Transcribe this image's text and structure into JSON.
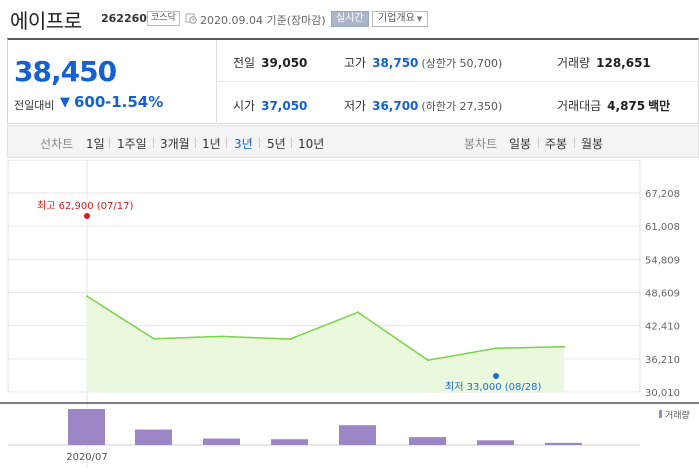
{
  "header": {
    "stock_name": "에이프로",
    "stock_code": "262260",
    "market": "코스닥",
    "date_text": "2020.09.04 기준(장마감)",
    "realtime_button": "실시간",
    "overview_button": "기업개요"
  },
  "quote": {
    "price": "38,450",
    "change_label": "전일대비",
    "change_value": "600",
    "change_rate": "-1.54%",
    "prev_close_label": "전일",
    "prev_close": "39,050",
    "high_label": "고가",
    "high": "38,750",
    "upper_limit": "(상한가 50,700)",
    "volume_label": "거래량",
    "volume": "128,651",
    "open_label": "시가",
    "open": "37,050",
    "low_label": "저가",
    "low": "36,700",
    "lower_limit": "(하한가 27,350)",
    "amount_label": "거래대금",
    "amount": "4,875",
    "amount_unit": "백만"
  },
  "period_bar": {
    "line_chart_label": "선차트",
    "line_options": [
      "1일",
      "1주일",
      "3개월",
      "1년",
      "3년",
      "5년",
      "10년"
    ],
    "active_option": "3년",
    "candle_chart_label": "봉차트",
    "candle_options": [
      "일봉",
      "주봉",
      "월봉"
    ]
  },
  "colors": {
    "accent": "#1361d3",
    "line": "#7ad447",
    "area": "#eaf8dd",
    "volume_bar": "#9d86c6",
    "high_marker": "#d21e1e",
    "low_marker": "#1e6cc9"
  },
  "chart_data": {
    "type": "area",
    "x_start_label": "2020/07",
    "y_ticks": [
      "67,208",
      "61,008",
      "54,809",
      "48,609",
      "42,410",
      "36,210",
      "30,010"
    ],
    "ylim": [
      30010,
      67208
    ],
    "values": [
      47900,
      39950,
      40400,
      39900,
      44900,
      35950,
      38200,
      38450
    ],
    "volume_legend": "거래량",
    "volume_values": [
      100,
      43,
      18,
      16,
      55,
      22,
      13,
      6
    ],
    "high_annotation": "최고 62,900 (07/17)",
    "high_value": 62900,
    "low_annotation": "최저 33,000 (08/28)",
    "low_value": 33000
  }
}
